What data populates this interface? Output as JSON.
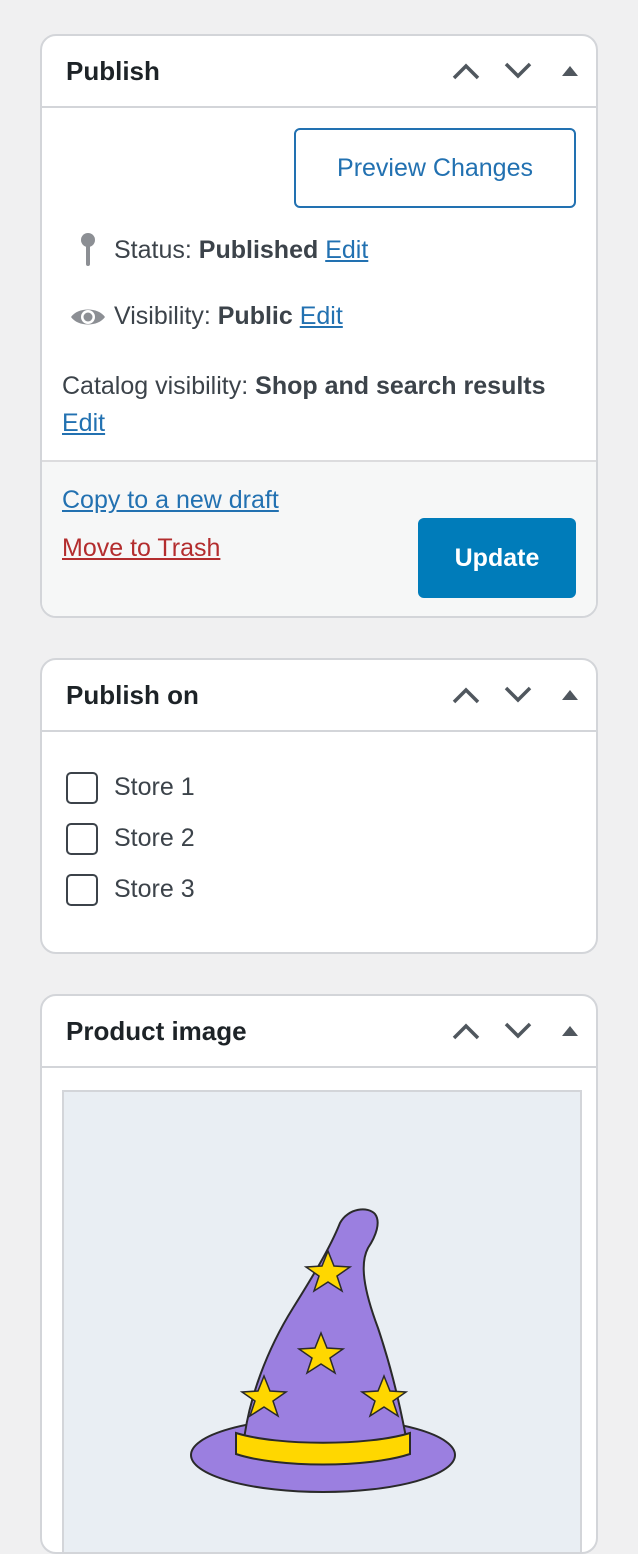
{
  "publish": {
    "title": "Publish",
    "preview_label": "Preview Changes",
    "status_label": "Status:",
    "status_value": "Published",
    "status_edit": "Edit",
    "visibility_label": "Visibility:",
    "visibility_value": "Public",
    "visibility_edit": "Edit",
    "catalog_label": "Catalog visibility:",
    "catalog_value": "Shop and search results",
    "catalog_edit": "Edit",
    "copy_label": "Copy to a new draft",
    "trash_label": "Move to Trash",
    "update_label": "Update"
  },
  "publish_on": {
    "title": "Publish on",
    "stores": [
      {
        "label": "Store 1",
        "checked": false
      },
      {
        "label": "Store 2",
        "checked": false
      },
      {
        "label": "Store 3",
        "checked": false
      }
    ]
  },
  "product_image": {
    "title": "Product image"
  },
  "icons": {
    "move_up": "chevron-up-icon",
    "move_down": "chevron-down-icon",
    "toggle": "triangle-up-icon",
    "status": "pin-icon",
    "visibility": "eye-icon"
  },
  "colors": {
    "link": "#2271b1",
    "primary_button": "#007cba",
    "trash": "#b32d2e",
    "hat": "#9b7fe0",
    "star": "#ffd700"
  }
}
